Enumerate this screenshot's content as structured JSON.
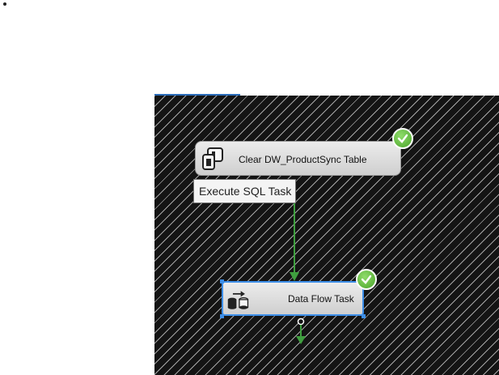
{
  "page": {
    "bullet": "•"
  },
  "canvas": {
    "background": "#141414",
    "hatch_color": "#ffffff",
    "tab_accent": "#2b6cb8"
  },
  "tasks": [
    {
      "label": "Clear DW_ProductSync Table",
      "icon": "execute-sql-task-icon",
      "status": "success",
      "selected": false
    },
    {
      "label": "Data Flow Task",
      "icon": "data-flow-task-icon",
      "status": "success",
      "selected": true,
      "selection_color": "#3d8ee8"
    }
  ],
  "tooltip": {
    "text": "Execute SQL Task"
  },
  "precedence_constraint": {
    "type": "success",
    "color": "#3f9f3f"
  },
  "colors": {
    "success_check": "#4aa32a",
    "selection": "#3d8ee8"
  }
}
